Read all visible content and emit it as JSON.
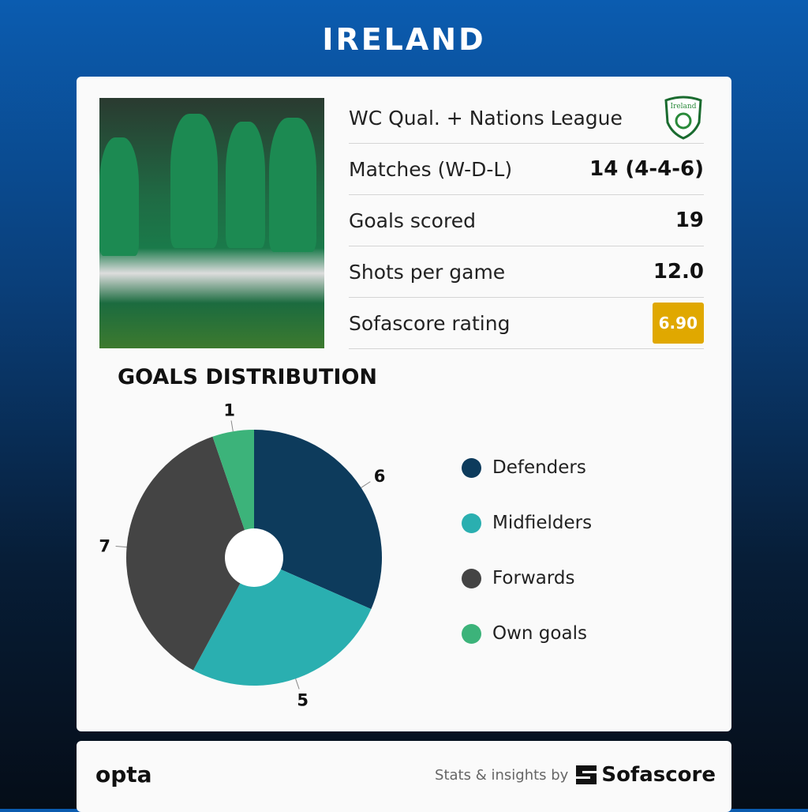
{
  "title": "IRELAND",
  "competition": "WC Qual. + Nations League",
  "crest_text": "Ireland",
  "stats": [
    {
      "label": "Matches (W-D-L)",
      "value": "14 (4-4-6)"
    },
    {
      "label": "Goals scored",
      "value": "19"
    },
    {
      "label": "Shots per game",
      "value": "12.0"
    },
    {
      "label": "Sofascore rating",
      "value": "6.90"
    }
  ],
  "rating_color": "#e0a800",
  "section_title": "GOALS DISTRIBUTION",
  "chart_data": {
    "type": "pie",
    "categories": [
      "Defenders",
      "Midfielders",
      "Forwards",
      "Own goals"
    ],
    "values": [
      6,
      5,
      7,
      1
    ],
    "colors": [
      "#0d3b5c",
      "#2aafb0",
      "#444444",
      "#3cb37a"
    ],
    "legend": "right",
    "donut": true
  },
  "footer": {
    "opta": "opta",
    "by": "Stats & insights by",
    "brand": "Sofascore"
  }
}
